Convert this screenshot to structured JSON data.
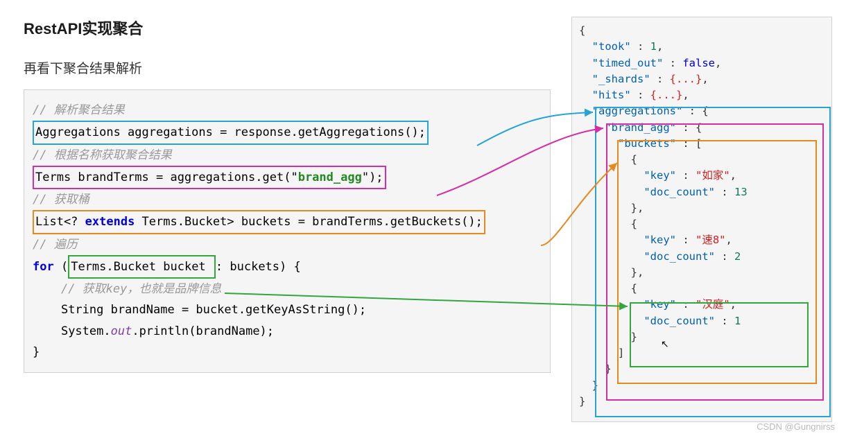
{
  "title": "RestAPI实现聚合",
  "subtitle": "再看下聚合结果解析",
  "code": {
    "c1": "// 解析聚合结果",
    "l1": "Aggregations aggregations = response.getAggregations();",
    "c2": "// 根据名称获取聚合结果",
    "l2a": "Terms brandTerms = aggregations.get(\"",
    "l2b": "brand_agg",
    "l2c": "\");",
    "c3": "// 获取桶",
    "l3a": "List<? ",
    "l3kw": "extends",
    "l3b": " Terms.Bucket> buckets = brandTerms.getBuckets();",
    "c4": "// 遍历",
    "l4kw": "for",
    "l4a": " (",
    "l4box": "Terms.Bucket bucket ",
    "l4b": ": buckets) {",
    "c5": "// 获取key，也就是品牌信息",
    "l5": "String brandName = bucket.getKeyAsString();",
    "l6a": "System.",
    "l6out": "out",
    "l6b": ".println(brandName);",
    "l7": "}"
  },
  "json": {
    "took_k": "\"took\"",
    "took_v": "1",
    "timed_k": "\"timed_out\"",
    "timed_v": "false",
    "shards_k": "\"_shards\"",
    "shards_v": "{...}",
    "hits_k": "\"hits\"",
    "hits_v": "{...}",
    "agg_k": "\"aggregations\"",
    "brand_k": "\"brand_agg\"",
    "buckets_k": "\"buckets\"",
    "kkey": "\"key\"",
    "kdc": "\"doc_count\"",
    "v1k": "\"如家\"",
    "v1d": "13",
    "v2k": "\"速8\"",
    "v2d": "2",
    "v3k": "\"汉庭\"",
    "v3d": "1"
  },
  "watermark": "CSDN @Gungnirss"
}
